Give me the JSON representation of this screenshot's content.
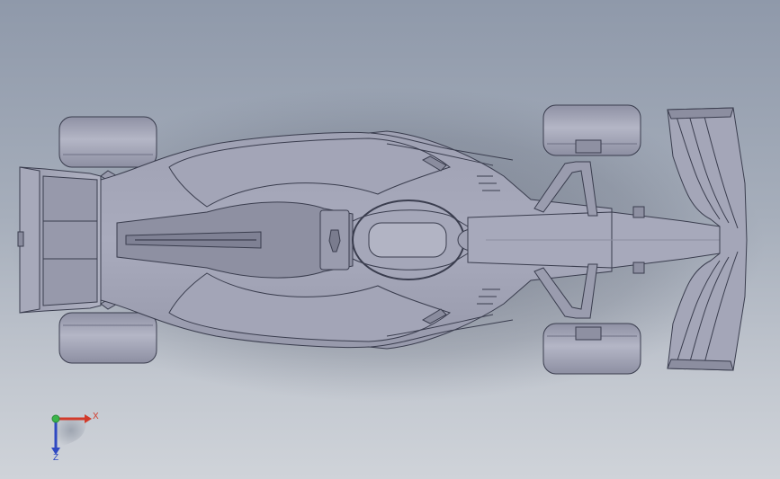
{
  "viewport": {
    "background_top": "#8f99aa",
    "background_bottom": "#cfd3d9",
    "model_color": "#9c9eb0",
    "model_edge_color": "#3a3d4e"
  },
  "triad": {
    "x_label": "X",
    "z_label": "Z",
    "y_color": "#3ab54a",
    "x_color": "#d23a2a",
    "z_color": "#2f49c2"
  }
}
